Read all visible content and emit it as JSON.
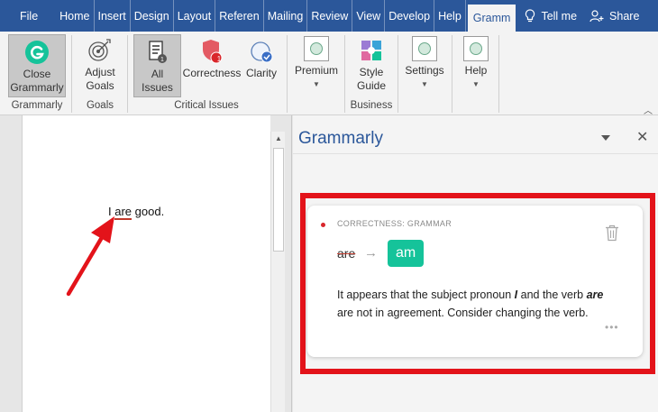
{
  "menubar": {
    "tabs": [
      "File",
      "Home",
      "Insert",
      "Design",
      "Layout",
      "Referen",
      "Mailing",
      "Review",
      "View",
      "Develop",
      "Help"
    ],
    "active_tab": "Gramm",
    "tell_me": "Tell me",
    "share": "Share"
  },
  "ribbon": {
    "close_grammarly": "Close Grammarly",
    "adjust_goals": "Adjust Goals",
    "all_issues": "All Issues",
    "correctness": "Correctness",
    "correctness_badge": "1",
    "clarity": "Clarity",
    "premium": "Premium",
    "style_guide": "Style Guide",
    "settings": "Settings",
    "help": "Help",
    "groups": {
      "grammarly": "Grammarly",
      "goals": "Goals",
      "critical_issues": "Critical Issues",
      "business": "Business"
    }
  },
  "document": {
    "before": "I ",
    "error_word": "are",
    "after": " good."
  },
  "pane": {
    "title": "Grammarly",
    "card": {
      "category": "CORRECTNESS: GRAMMAR",
      "original": "are",
      "arrow": "→",
      "suggestion": "am",
      "msg_part1": "It appears that the subject pronoun ",
      "msg_bold1": "I",
      "msg_part2": " and the verb ",
      "msg_bold2": "are",
      "msg_part3": " are not in agreement. Consider changing the verb."
    }
  },
  "colors": {
    "brand_blue": "#2b579a",
    "grammarly_green": "#15c39a",
    "highlight_red": "#e3131a"
  }
}
